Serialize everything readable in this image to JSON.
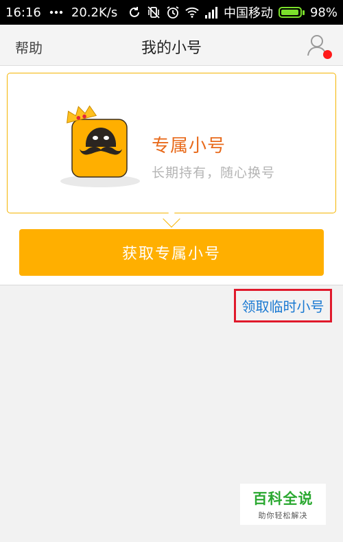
{
  "status_bar": {
    "time": "16:16",
    "net_speed": "20.2K/s",
    "carrier": "中国移动",
    "battery_percent": "98%",
    "battery_level": 0.98,
    "icons": [
      "sync-icon",
      "vibrate-icon",
      "alarm-icon",
      "wifi-icon",
      "signal-icon",
      "battery-icon"
    ]
  },
  "nav": {
    "help_label": "帮助",
    "title": "我的小号",
    "user_icon": "user-icon",
    "notification_dot_color": "#ff1a1a"
  },
  "card": {
    "title": "专属小号",
    "subtitle": "长期持有，随心换号",
    "border_color": "#f5b400",
    "title_color": "#e86a1b"
  },
  "get_button": {
    "label": "获取专属小号",
    "color": "#ffaf00"
  },
  "temp_link": {
    "label": "领取临时小号",
    "color": "#1a79d2",
    "highlight_color": "#e0192b"
  },
  "watermark": {
    "title": "百科全说",
    "subtitle": "助你轻松解决"
  }
}
